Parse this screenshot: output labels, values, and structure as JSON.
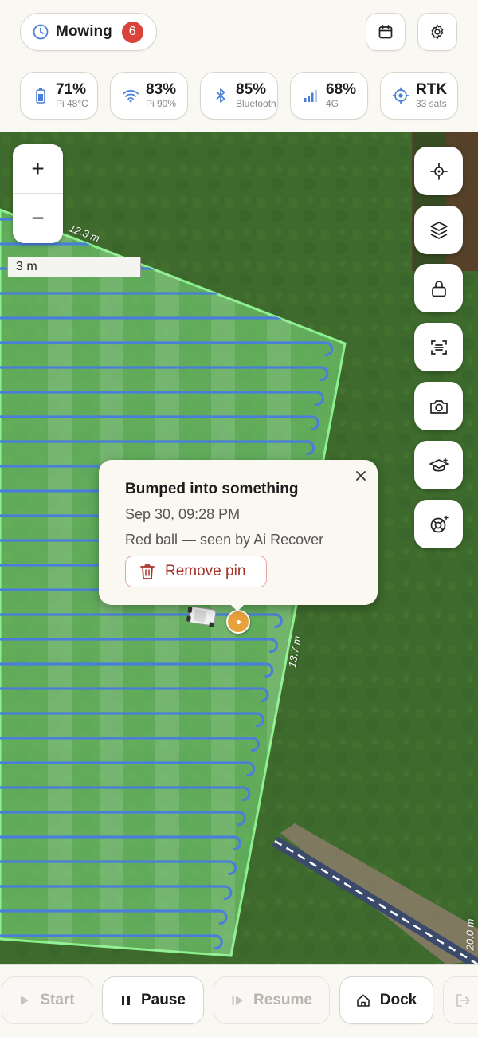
{
  "status": {
    "mode_label": "Mowing",
    "notification_count": "6"
  },
  "header_actions": [
    {
      "name": "calendar",
      "icon": "calendar-icon"
    },
    {
      "name": "settings",
      "icon": "gear-icon"
    }
  ],
  "stats": [
    {
      "icon": "battery-icon",
      "value": "71%",
      "sub": "Pi 48°C"
    },
    {
      "icon": "wifi-icon",
      "value": "83%",
      "sub": "Pi 90%"
    },
    {
      "icon": "bluetooth-icon",
      "value": "85%",
      "sub": "Bluetooth"
    },
    {
      "icon": "cellular-signal-icon",
      "value": "68%",
      "sub": "4G"
    },
    {
      "icon": "gps-target-icon",
      "value": "RTK",
      "sub": "33 sats"
    }
  ],
  "map": {
    "zoom_in": "+",
    "zoom_out": "−",
    "scale_label": "3 m",
    "edge_labels": [
      "12.3 m",
      "13.7 m",
      "20.0 m"
    ],
    "tools": [
      {
        "name": "locate",
        "icon": "crosshair-icon"
      },
      {
        "name": "layers",
        "icon": "layers-icon"
      },
      {
        "name": "lock",
        "icon": "lock-icon"
      },
      {
        "name": "scan",
        "icon": "scan-icon"
      },
      {
        "name": "camera",
        "icon": "camera-icon"
      },
      {
        "name": "training",
        "icon": "graduation-cap-icon"
      },
      {
        "name": "help",
        "icon": "lifebuoy-icon"
      }
    ]
  },
  "popup": {
    "title": "Bumped into something",
    "date": "Sep 30, 09:28 PM",
    "description": "Red ball — seen by Ai Recover",
    "remove_label": "Remove pin"
  },
  "controls": {
    "start": "Start",
    "pause": "Pause",
    "resume": "Resume",
    "dock": "Dock"
  },
  "colors": {
    "accent_red": "#d9433b",
    "path_blue": "#4a7fd9",
    "zone_green": "#7ee081",
    "pin_orange": "#e8a23b"
  }
}
